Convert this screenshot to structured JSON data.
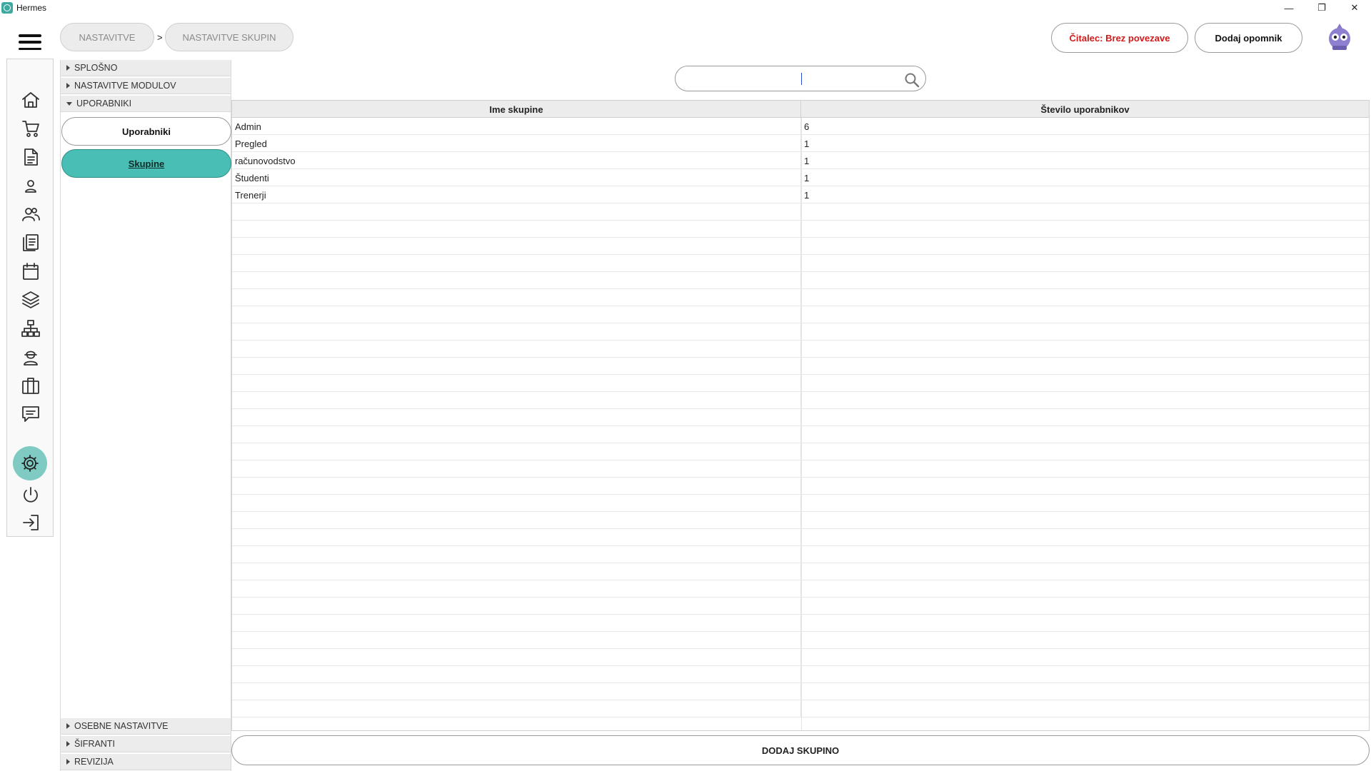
{
  "window": {
    "title": "Hermes",
    "controls": {
      "minimize": "—",
      "restore": "❐",
      "close": "✕"
    }
  },
  "header": {
    "breadcrumbs": [
      "NASTAVITVE",
      "NASTAVITVE SKUPIN"
    ],
    "separator": ">",
    "reader_status": "Čitalec: Brez povezave",
    "reader_status_color": "#d11a1a",
    "add_reminder": "Dodaj opomnik"
  },
  "navbar": {
    "items": [
      "home-icon",
      "cart-icon",
      "document-icon",
      "person-icon",
      "people-icon",
      "list-document-icon",
      "calendar-icon",
      "layers-icon",
      "network-icon",
      "worker-icon",
      "briefcase-icon",
      "comment-icon",
      "settings-icon",
      "power-icon",
      "logout-icon"
    ],
    "active": "settings-icon",
    "accent_color": "#7fcbc4"
  },
  "tree": {
    "sections_top": [
      "SPLOŠNO",
      "NASTAVITVE MODULOV",
      "UPORABNIKI"
    ],
    "expanded": "UPORABNIKI",
    "subitems": [
      "Uporabniki",
      "Skupine"
    ],
    "active_subitem": "Skupine",
    "sections_bottom": [
      "OSEBNE NASTAVITVE",
      "ŠIFRANTI",
      "REVIZIJA"
    ]
  },
  "search": {
    "value": "",
    "placeholder": ""
  },
  "table": {
    "columns": [
      "Ime skupine",
      "Število uporabnikov"
    ],
    "rows": [
      [
        "Admin",
        "6"
      ],
      [
        "Pregled",
        "1"
      ],
      [
        "računovodstvo",
        "1"
      ],
      [
        "Študenti",
        "1"
      ],
      [
        "Trenerji",
        "1"
      ]
    ]
  },
  "footer": {
    "add_group": "DODAJ SKUPINO"
  },
  "colors": {
    "accent": "#49beb4",
    "header_bg": "#ececec"
  }
}
